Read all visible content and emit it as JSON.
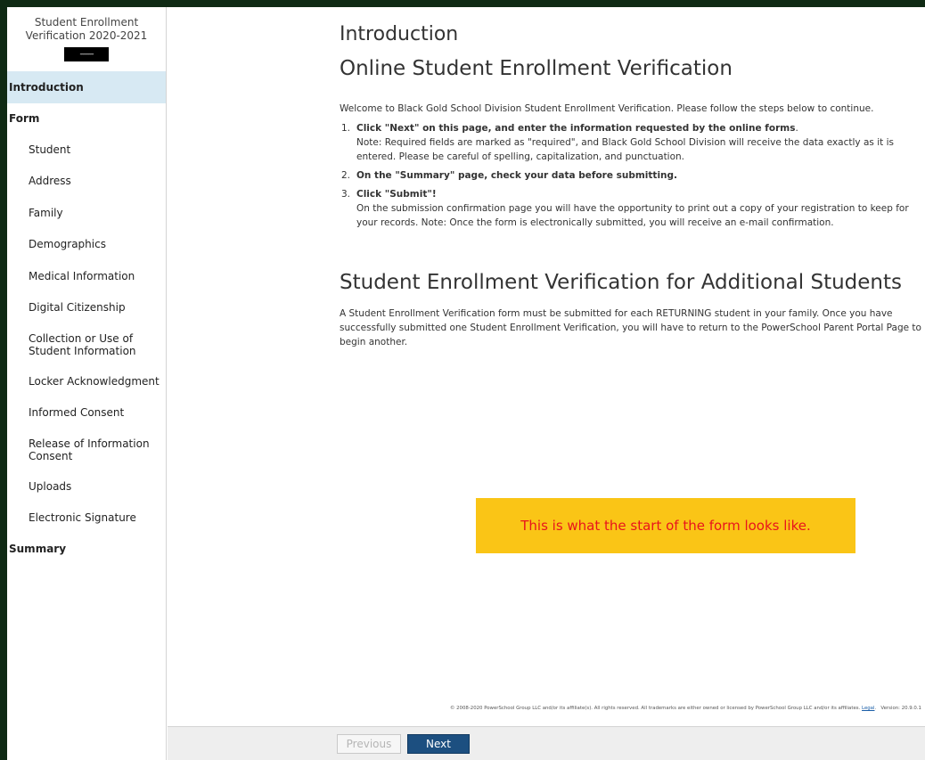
{
  "sidebar": {
    "title": "Student Enrollment Verification 2020-2021",
    "redacted_text": "--------",
    "items": [
      {
        "label": "Introduction"
      },
      {
        "label": "Form"
      },
      {
        "label": "Student"
      },
      {
        "label": "Address"
      },
      {
        "label": "Family"
      },
      {
        "label": "Demographics"
      },
      {
        "label": "Medical Information"
      },
      {
        "label": "Digital Citizenship"
      },
      {
        "label": "Collection or Use of Student Information"
      },
      {
        "label": "Locker Acknowledgment"
      },
      {
        "label": "Informed Consent"
      },
      {
        "label": "Release of Information Consent"
      },
      {
        "label": "Uploads"
      },
      {
        "label": "Electronic Signature"
      },
      {
        "label": "Summary"
      }
    ],
    "active_item": "Introduction"
  },
  "main": {
    "page_title": "Introduction",
    "heading": "Online Student Enrollment Verification",
    "welcome": "Welcome to Black Gold School Division Student Enrollment Verification.  Please follow the steps below to continue.",
    "steps": [
      {
        "num": "1.",
        "bold": "Click \"Next\" on this page, and enter the information requested by the online forms",
        "tail": ".",
        "detail": "Note: Required fields are marked as \"required\", and Black Gold School Division will receive the data exactly as it is entered.  Please be careful of spelling, capitalization, and punctuation."
      },
      {
        "num": "2.",
        "bold": "On the \"Summary\" page, check your data before submitting.",
        "tail": "",
        "detail": ""
      },
      {
        "num": "3.",
        "bold": "Click \"Submit\"!",
        "tail": "",
        "detail": "On the submission confirmation page you will have the opportunity to print out a copy of your registration to keep for your records.  Note:  Once the form is electronically submitted, you will receive an e-mail confirmation."
      }
    ],
    "heading2": "Student Enrollment Verification for Additional Students",
    "additional": "A Student Enrollment Verification form must be submitted for each RETURNING student in your family. Once you have successfully submitted one Student Enrollment Verification, you will have to return to the PowerSchool Parent Portal Page to begin another."
  },
  "annotation": {
    "text": "This is what the start of the form looks like.",
    "bg_color": "#fac516",
    "text_color": "#e8141c"
  },
  "footer": {
    "copyright": "© 2008-2020 PowerSchool Group LLC and/or its affiliate(s). All rights reserved. All trademarks are either owned or licensed by PowerSchool Group LLC and/or its affiliates.",
    "legal_link": "Legal",
    "version": "Version: 20.9.0.1"
  },
  "actions": {
    "previous_label": "Previous",
    "next_label": "Next",
    "next_color": "#1c4f80"
  }
}
